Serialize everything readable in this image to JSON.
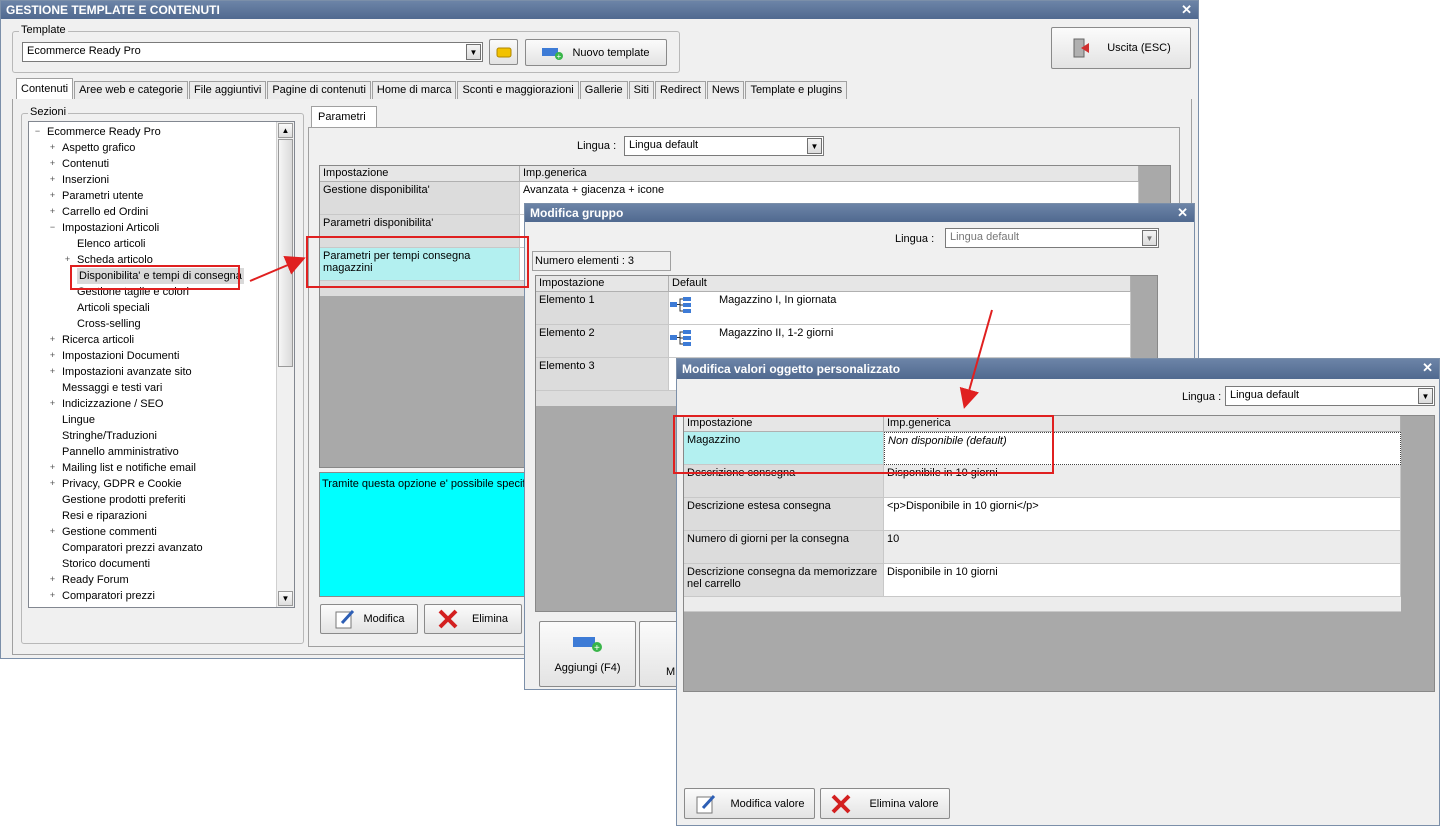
{
  "main_window": {
    "title": "GESTIONE TEMPLATE E CONTENUTI",
    "template_group_label": "Template",
    "template_value": "Ecommerce Ready Pro",
    "new_template_label": "Nuovo template",
    "exit_label": "Uscita (ESC)",
    "tabs": [
      "Contenuti",
      "Aree web e categorie",
      "File aggiuntivi",
      "Pagine di contenuti",
      "Home di marca",
      "Sconti e maggiorazioni",
      "Gallerie",
      "Siti",
      "Redirect",
      "News",
      "Template e plugins"
    ],
    "sections_label": "Sezioni",
    "tree": [
      {
        "label": "Ecommerce Ready Pro",
        "level": 0,
        "toggle": "−"
      },
      {
        "label": "Aspetto grafico",
        "level": 1,
        "toggle": "+"
      },
      {
        "label": "Contenuti",
        "level": 1,
        "toggle": "+"
      },
      {
        "label": "Inserzioni",
        "level": 1,
        "toggle": "+"
      },
      {
        "label": "Parametri utente",
        "level": 1,
        "toggle": "+"
      },
      {
        "label": "Carrello ed Ordini",
        "level": 1,
        "toggle": "+"
      },
      {
        "label": "Impostazioni Articoli",
        "level": 1,
        "toggle": "−"
      },
      {
        "label": "Elenco articoli",
        "level": 2,
        "toggle": ""
      },
      {
        "label": "Scheda articolo",
        "level": 2,
        "toggle": "+"
      },
      {
        "label": "Disponibilita' e tempi di consegna",
        "level": 2,
        "toggle": "",
        "selected": true
      },
      {
        "label": "Gestione taglie e colori",
        "level": 2,
        "toggle": ""
      },
      {
        "label": "Articoli speciali",
        "level": 2,
        "toggle": ""
      },
      {
        "label": "Cross-selling",
        "level": 2,
        "toggle": ""
      },
      {
        "label": "Ricerca articoli",
        "level": 1,
        "toggle": "+"
      },
      {
        "label": "Impostazioni Documenti",
        "level": 1,
        "toggle": "+"
      },
      {
        "label": "Impostazioni avanzate sito",
        "level": 1,
        "toggle": "+"
      },
      {
        "label": "Messaggi e testi vari",
        "level": 1,
        "toggle": ""
      },
      {
        "label": "Indicizzazione / SEO",
        "level": 1,
        "toggle": "+"
      },
      {
        "label": "Lingue",
        "level": 1,
        "toggle": ""
      },
      {
        "label": "Stringhe/Traduzioni",
        "level": 1,
        "toggle": ""
      },
      {
        "label": "Pannello amministrativo",
        "level": 1,
        "toggle": ""
      },
      {
        "label": "Mailing list e notifiche email",
        "level": 1,
        "toggle": "+"
      },
      {
        "label": "Privacy, GDPR e Cookie",
        "level": 1,
        "toggle": "+"
      },
      {
        "label": "Gestione prodotti preferiti",
        "level": 1,
        "toggle": ""
      },
      {
        "label": "Resi e riparazioni",
        "level": 1,
        "toggle": ""
      },
      {
        "label": "Gestione commenti",
        "level": 1,
        "toggle": "+"
      },
      {
        "label": "Comparatori prezzi avanzato",
        "level": 1,
        "toggle": ""
      },
      {
        "label": "Storico documenti",
        "level": 1,
        "toggle": ""
      },
      {
        "label": "Ready Forum",
        "level": 1,
        "toggle": "+"
      },
      {
        "label": "Comparatori prezzi",
        "level": 1,
        "toggle": "+"
      }
    ],
    "params_tab": "Parametri",
    "lingua_label": "Lingua :",
    "lingua_value": "Lingua default",
    "grid_headers": [
      "Impostazione",
      "Imp.generica"
    ],
    "grid_rows": [
      {
        "label": "Gestione disponibilita'",
        "value": "Avanzata + giacenza + icone"
      },
      {
        "label": "Parametri disponibilita'",
        "value": ""
      },
      {
        "label": "Parametri per tempi consegna magazzini",
        "value": ""
      }
    ],
    "description": "Tramite questa opzione e' possibile specific",
    "modifica_label": "Modifica",
    "elimina_label": "Elimina"
  },
  "group_window": {
    "title": "Modifica gruppo",
    "lingua_label": "Lingua :",
    "lingua_value": "Lingua default",
    "count_label": "Numero elementi : 3",
    "headers": [
      "Impostazione",
      "Default"
    ],
    "rows": [
      {
        "label": "Elemento 1",
        "value": "Magazzino I, In giornata"
      },
      {
        "label": "Elemento 2",
        "value": "Magazzino II, 1-2 giorni"
      },
      {
        "label": "Elemento 3",
        "value": ""
      }
    ],
    "add_label": "Aggiungi (F4)",
    "mod_label_partial": "M"
  },
  "custom_window": {
    "title": "Modifica valori oggetto personalizzato",
    "lingua_label": "Lingua :",
    "lingua_value": "Lingua default",
    "headers": [
      "Impostazione",
      "Imp.generica"
    ],
    "rows": [
      {
        "label": "Magazzino",
        "value": "Non disponibile (default)"
      },
      {
        "label": "Descrizione consegna",
        "value": "Disponibile in 10 giorni"
      },
      {
        "label": "Descrizione estesa consegna",
        "value": "<p>Disponibile in 10 giorni</p>"
      },
      {
        "label": "Numero di giorni per la consegna",
        "value": "10"
      },
      {
        "label": "Descrizione consegna da memorizzare nel carrello",
        "value": "Disponibile in 10 giorni"
      }
    ],
    "edit_value_label": "Modifica valore",
    "delete_value_label": "Elimina valore"
  },
  "colors": {
    "selection": "#b3f0f0",
    "description_bg": "#00ffff",
    "annotation": "#e02020",
    "titlebar": "#5a7398"
  }
}
